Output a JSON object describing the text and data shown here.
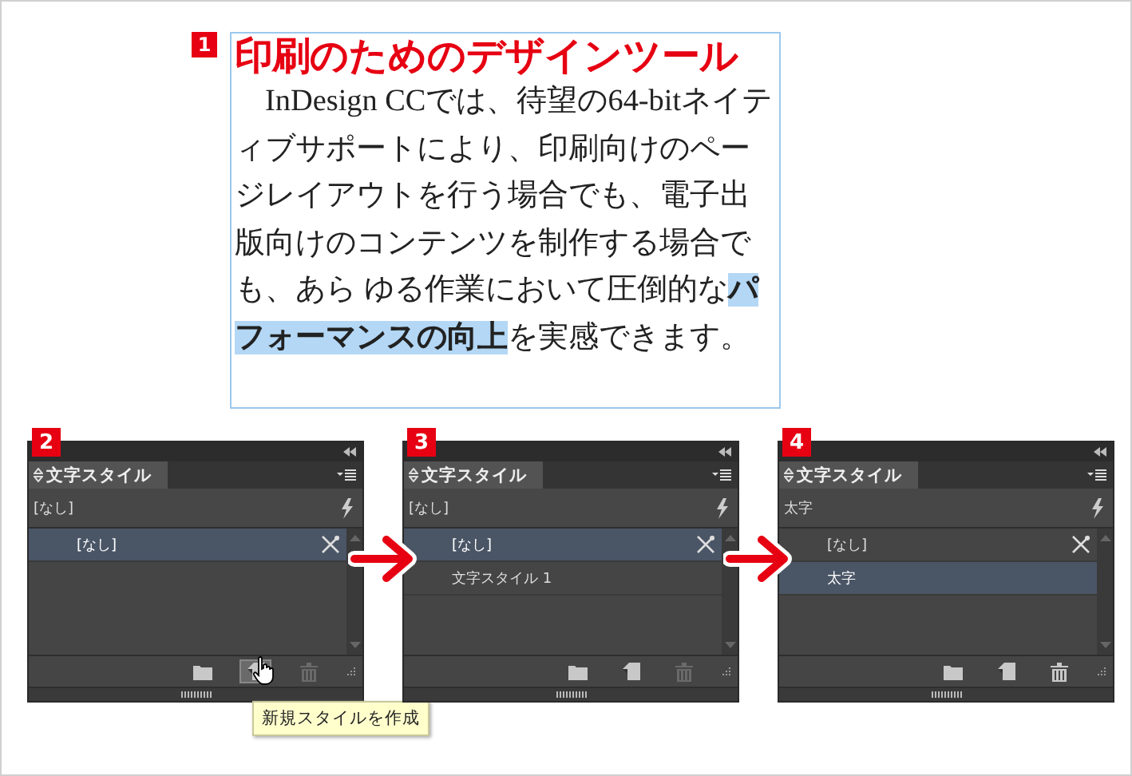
{
  "text_frame": {
    "step": "1",
    "title": "印刷のためのデザインツール",
    "body": "　InDesign CCでは、待望の64-bitネイティブサポートにより、印刷向けのページレイアウトを行う場合でも、電子出版向けのコンテンツを制作する場合でも、あら ゆる作業において圧倒的な**パフォーマンスの向上**を実感できます。"
  },
  "panels": [
    {
      "step": "2",
      "tab": "文字スタイル",
      "current_style": "[なし]",
      "rows": [
        {
          "label": "[なし]",
          "selected": true,
          "default": true
        }
      ],
      "buttons": [
        {
          "kind": "folder",
          "pressed": false,
          "disabled": false
        },
        {
          "kind": "new",
          "pressed": true,
          "disabled": false
        },
        {
          "kind": "trash",
          "pressed": false,
          "disabled": true
        }
      ],
      "tooltip": "新規スタイルを作成"
    },
    {
      "step": "3",
      "tab": "文字スタイル",
      "current_style": "[なし]",
      "rows": [
        {
          "label": "[なし]",
          "selected": true,
          "default": true
        },
        {
          "label": "文字スタイル 1",
          "selected": false,
          "default": false
        }
      ],
      "buttons": [
        {
          "kind": "folder",
          "pressed": false,
          "disabled": false
        },
        {
          "kind": "new",
          "pressed": false,
          "disabled": false
        },
        {
          "kind": "trash",
          "pressed": false,
          "disabled": true
        }
      ]
    },
    {
      "step": "4",
      "tab": "文字スタイル",
      "current_style": "太字",
      "rows": [
        {
          "label": "[なし]",
          "selected": false,
          "default": true
        },
        {
          "label": "太字",
          "selected": true,
          "default": false
        }
      ],
      "buttons": [
        {
          "kind": "folder",
          "pressed": false,
          "disabled": false
        },
        {
          "kind": "new",
          "pressed": false,
          "disabled": false
        },
        {
          "kind": "trash",
          "pressed": false,
          "disabled": false
        }
      ]
    }
  ]
}
